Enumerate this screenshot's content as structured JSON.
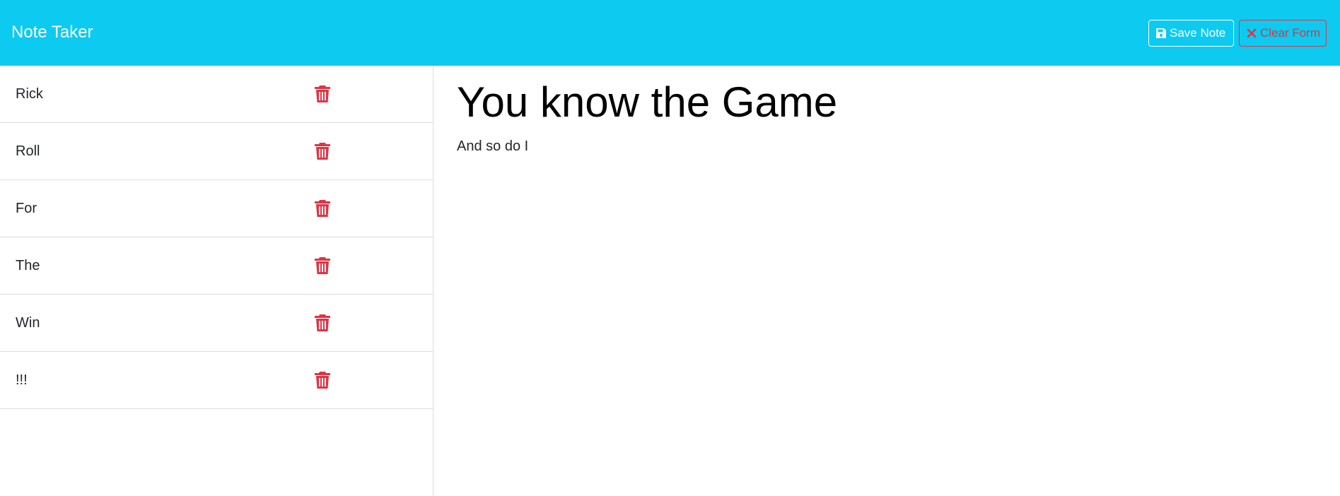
{
  "app": {
    "brand": "Note Taker"
  },
  "toolbar": {
    "save_label": "Save Note",
    "clear_label": "Clear Form"
  },
  "notes": [
    {
      "title": "Rick"
    },
    {
      "title": "Roll"
    },
    {
      "title": "For"
    },
    {
      "title": "The"
    },
    {
      "title": "Win"
    },
    {
      "title": "!!!"
    }
  ],
  "active_note": {
    "title": "You know the Game",
    "text": "And so do I"
  },
  "icons": {
    "save": "floppy-disk-icon",
    "clear": "x-icon",
    "delete": "trash-icon"
  },
  "colors": {
    "navbar": "#0dcaf0",
    "danger": "#dc3545"
  }
}
